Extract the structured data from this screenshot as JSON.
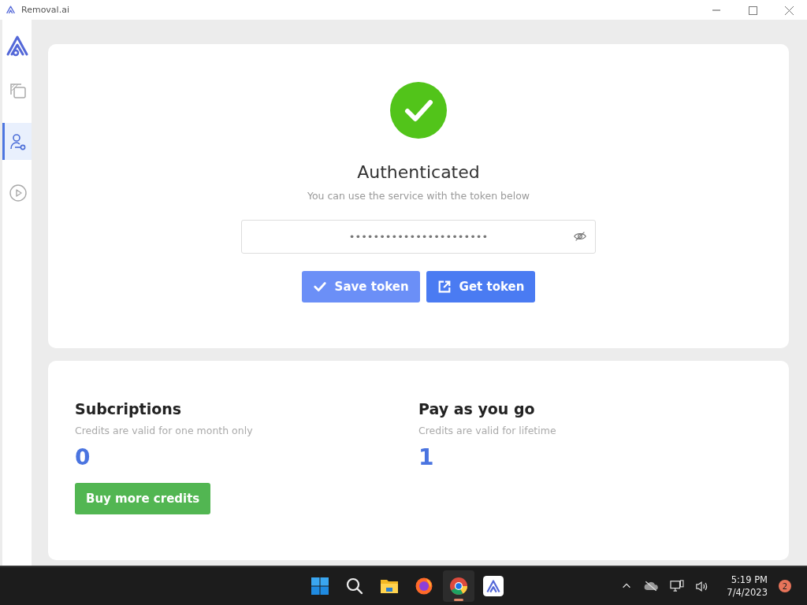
{
  "window": {
    "title": "Removal.ai"
  },
  "sidebar": {
    "items": [
      {
        "kind": "gallery",
        "selected": false
      },
      {
        "kind": "account",
        "selected": true
      },
      {
        "kind": "play",
        "selected": false
      }
    ]
  },
  "auth": {
    "status": "Authenticated",
    "hint": "You can use the service with the token below",
    "token": "•••••••••••••••••••••••",
    "buttons": [
      {
        "label": "Save token",
        "kind": "save"
      },
      {
        "label": "Get token",
        "kind": "open"
      }
    ]
  },
  "credits": [
    {
      "title": "Subcriptions",
      "note": "Credits are valid for one month only",
      "count": "0"
    },
    {
      "title": "Pay as you go",
      "note": "Credits are valid for lifetime",
      "count": "1"
    }
  ],
  "buy_button": "Buy more credits",
  "taskbar": {
    "apps": [
      {
        "kind": "start",
        "selected": false
      },
      {
        "kind": "search",
        "selected": false
      },
      {
        "kind": "files",
        "selected": false
      },
      {
        "kind": "firefox",
        "selected": false
      },
      {
        "kind": "chrome",
        "selected": true
      },
      {
        "kind": "removal",
        "selected": false
      }
    ],
    "time": "5:19 PM",
    "date": "7/4/2023",
    "notifications": "2"
  }
}
